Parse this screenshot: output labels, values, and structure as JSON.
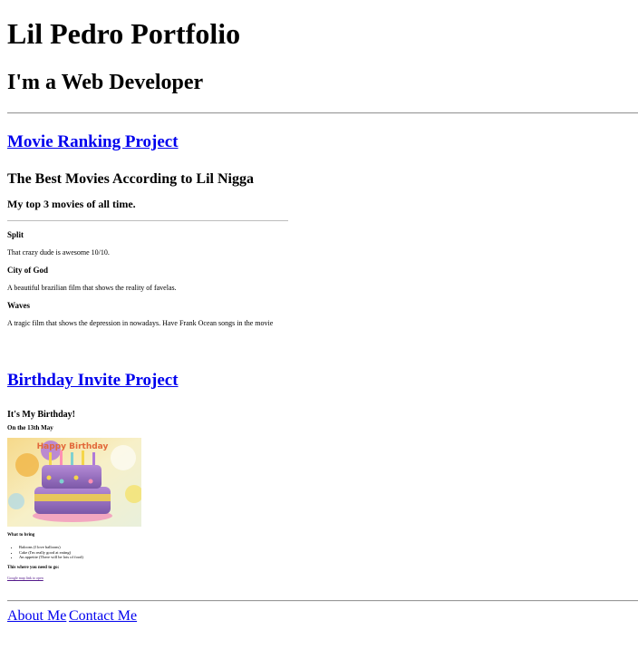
{
  "header": {
    "title": "Lil Pedro Portfolio",
    "subtitle": "I'm a Web Developer"
  },
  "projects": {
    "movie_link": "Movie Ranking Project",
    "birthday_link": "Birthday Invite Project"
  },
  "movie_page": {
    "heading": "The Best Movies According to Lil Nigga",
    "subheading": "My top 3 movies of all time.",
    "movies": [
      {
        "name": "Split",
        "description": "That crazy dude is awesome 10/10."
      },
      {
        "name": "City of God",
        "description": "A beautiful brazilian film that shows the reality of favelas."
      },
      {
        "name": "Waves",
        "description": "A tragic film that shows the depression in nowadays. Have Frank Ocean songs in the movie"
      }
    ]
  },
  "birthday_page": {
    "heading": "It's My Birthday!",
    "date": "On the 13th May",
    "cake_image_text": "Happy Birthday",
    "bring_heading": "What to bring",
    "bring_items": [
      "Baloons (I love balloons)",
      "Cake (I'm really good at eating)",
      "An appetite (There will be lots of food)"
    ],
    "location_heading": "This where you need to go:",
    "map_link": "Google map link to open"
  },
  "footer": {
    "about": "About Me",
    "contact": "Contact Me"
  }
}
